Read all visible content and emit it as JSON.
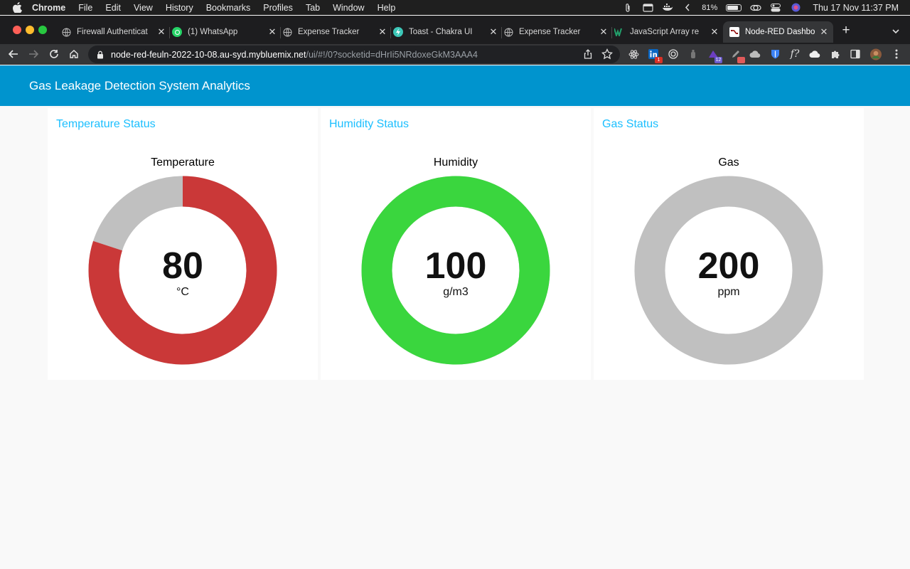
{
  "menubar": {
    "app_name": "Chrome",
    "items": [
      "File",
      "Edit",
      "View",
      "History",
      "Bookmarks",
      "Profiles",
      "Tab",
      "Window",
      "Help"
    ],
    "battery_percent": "81%",
    "battery_level": 0.81,
    "clock": "Thu 17 Nov  11:37 PM"
  },
  "browser": {
    "tabs": [
      {
        "title": "Firewall Authenticat",
        "icon": "globe-icon"
      },
      {
        "title": "(1) WhatsApp",
        "icon": "whatsapp-icon"
      },
      {
        "title": "Expense Tracker",
        "icon": "globe-icon"
      },
      {
        "title": "Toast - Chakra UI",
        "icon": "chakra-icon"
      },
      {
        "title": "Expense Tracker",
        "icon": "globe-icon"
      },
      {
        "title": "JavaScript Array re",
        "icon": "w3-icon"
      },
      {
        "title": "Node-RED Dashbo",
        "icon": "node-red-icon",
        "active": true
      }
    ],
    "url_host": "node-red-feuln-2022-10-08.au-syd.mybluemix.net",
    "url_rest": "/ui/#!/0?socketid=dHrIi5NRdoxeGkM3AAA4",
    "extension_badges": {
      "linkedin": "1",
      "ext_12": "12"
    }
  },
  "dashboard": {
    "title": "Gas Leakage Detection System Analytics",
    "groups": [
      {
        "group_title": "Temperature Status",
        "gauge_title": "Temperature",
        "value": "80",
        "unit": "°C",
        "fill_fraction": 0.8,
        "fill_color": "#ca3838",
        "track_color": "#c0c0c0"
      },
      {
        "group_title": "Humidity Status",
        "gauge_title": "Humidity",
        "value": "100",
        "unit": "g/m3",
        "fill_fraction": 1.0,
        "fill_color": "#3ad63e",
        "track_color": "#c0c0c0"
      },
      {
        "group_title": "Gas Status",
        "gauge_title": "Gas",
        "value": "200",
        "unit": "ppm",
        "fill_fraction": 0.0,
        "fill_color": "#ca3838",
        "track_color": "#c0c0c0"
      }
    ]
  }
}
